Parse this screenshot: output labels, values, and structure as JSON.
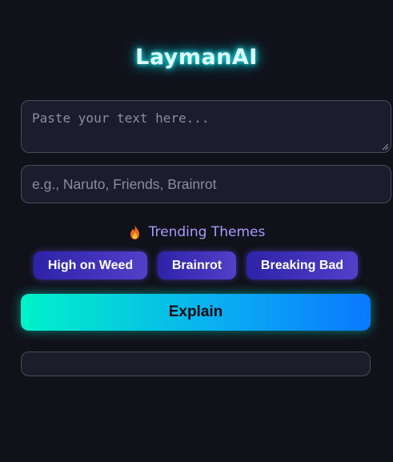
{
  "app": {
    "title": "LaymanAI"
  },
  "form": {
    "text_placeholder": "Paste your text here...",
    "text_value": "",
    "theme_placeholder": "e.g., Naruto, Friends, Brainrot",
    "theme_value": ""
  },
  "trending": {
    "icon": "fire-icon",
    "label": "Trending Themes",
    "themes": [
      "High on Weed",
      "Brainrot",
      "Breaking Bad"
    ]
  },
  "actions": {
    "explain_label": "Explain"
  },
  "output": {
    "text": ""
  },
  "colors": {
    "background": "#11111a",
    "title_glow": "#20e6e6",
    "accent_purple": "#a79bff",
    "chip_gradient_start": "#2d23a8",
    "chip_gradient_end": "#5240c8",
    "button_gradient_start": "#00f2c8",
    "button_gradient_end": "#0a78ff"
  }
}
